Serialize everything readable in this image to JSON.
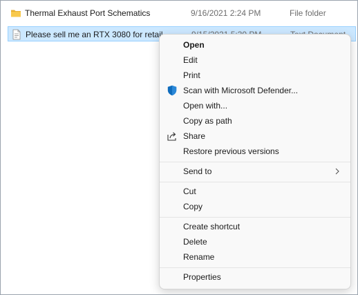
{
  "files": [
    {
      "name": "Thermal Exhaust Port Schematics",
      "date": "9/16/2021 2:24 PM",
      "type": "File folder",
      "icon": "folder-icon"
    },
    {
      "name": "Please sell me an RTX 3080 for retail",
      "date": "9/15/2021 5:30 PM",
      "type": "Text Document",
      "icon": "text-document-icon"
    }
  ],
  "menu": {
    "items": [
      {
        "label": "Open"
      },
      {
        "label": "Edit"
      },
      {
        "label": "Print"
      },
      {
        "label": "Scan with Microsoft Defender...",
        "icon": "defender-shield-icon"
      },
      {
        "label": "Open with..."
      },
      {
        "label": "Copy as path"
      },
      {
        "label": "Share",
        "icon": "share-icon"
      },
      {
        "label": "Restore previous versions"
      },
      {
        "label": "Send to",
        "icon": "chevron-right-icon"
      },
      {
        "label": "Cut"
      },
      {
        "label": "Copy"
      },
      {
        "label": "Create shortcut"
      },
      {
        "label": "Delete"
      },
      {
        "label": "Rename"
      },
      {
        "label": "Properties"
      }
    ]
  },
  "colors": {
    "selection": "#cce8ff",
    "defender_blue": "#0f6cbd",
    "folder_yellow": "#f8c94c"
  }
}
